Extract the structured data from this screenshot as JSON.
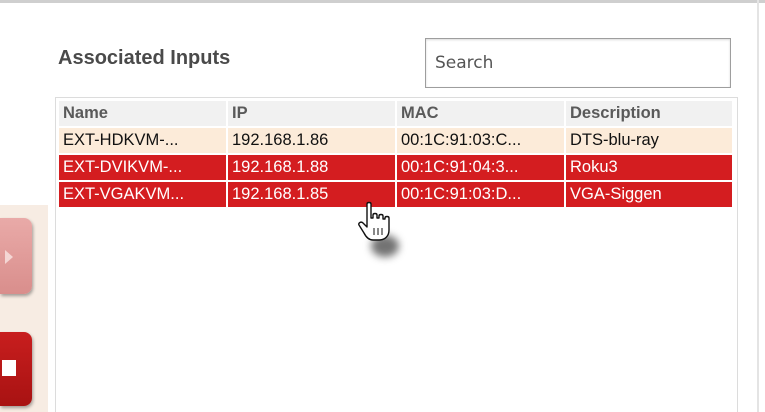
{
  "panel": {
    "title": "Associated Inputs"
  },
  "search": {
    "placeholder": "Search",
    "value": ""
  },
  "table": {
    "columns": [
      "Name",
      "IP",
      "MAC",
      "Description"
    ],
    "rows": [
      {
        "name": "EXT-HDKVM-...",
        "ip": "192.168.1.86",
        "mac": "00:1C:91:03:C...",
        "description": "DTS-blu-ray",
        "selected": false
      },
      {
        "name": "EXT-DVIKVM-...",
        "ip": "192.168.1.88",
        "mac": "00:1C:91:04:3...",
        "description": "Roku3",
        "selected": true
      },
      {
        "name": "EXT-VGAKVM...",
        "ip": "192.168.1.85",
        "mac": "00:1C:91:03:D...",
        "description": "VGA-Siggen",
        "selected": true
      }
    ]
  },
  "side_buttons": [
    {
      "icon": "play-arrow-icon",
      "state": "disabled"
    },
    {
      "icon": "stop-square-icon",
      "state": "enabled"
    }
  ],
  "cursor": {
    "icon": "hand-pointer-icon"
  },
  "colors": {
    "selected_row": "#d41d20",
    "row_bg": "#fcebd9",
    "header_bg": "#f1f1f1",
    "title_text": "#4a4a4a"
  }
}
